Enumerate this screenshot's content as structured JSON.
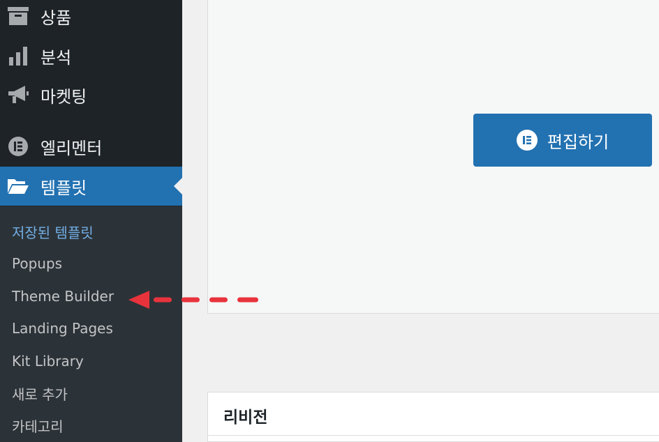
{
  "sidebar": {
    "menu": [
      {
        "label": "상품",
        "icon": "archive-icon"
      },
      {
        "label": "분석",
        "icon": "bar-chart-icon"
      },
      {
        "label": "마켓팅",
        "icon": "megaphone-icon"
      },
      {
        "label": "엘리멘터",
        "icon": "elementor-icon"
      },
      {
        "label": "템플릿",
        "icon": "folder-open-icon",
        "active": true
      }
    ],
    "submenu": [
      {
        "label": "저장된 템플릿",
        "current": true
      },
      {
        "label": "Popups"
      },
      {
        "label": "Theme Builder"
      },
      {
        "label": "Landing Pages"
      },
      {
        "label": "Kit Library"
      },
      {
        "label": "새로 추가"
      },
      {
        "label": "카테고리"
      }
    ]
  },
  "main": {
    "edit_button_label": "편집하기",
    "revisions_title": "리비전"
  },
  "annotation": {
    "arrow_target": "Theme Builder",
    "arrow_color": "#e8333c"
  },
  "colors": {
    "sidebar_bg": "#1d2327",
    "submenu_bg": "#2c3338",
    "accent": "#2271b1",
    "current_submenu": "#72aee6"
  }
}
